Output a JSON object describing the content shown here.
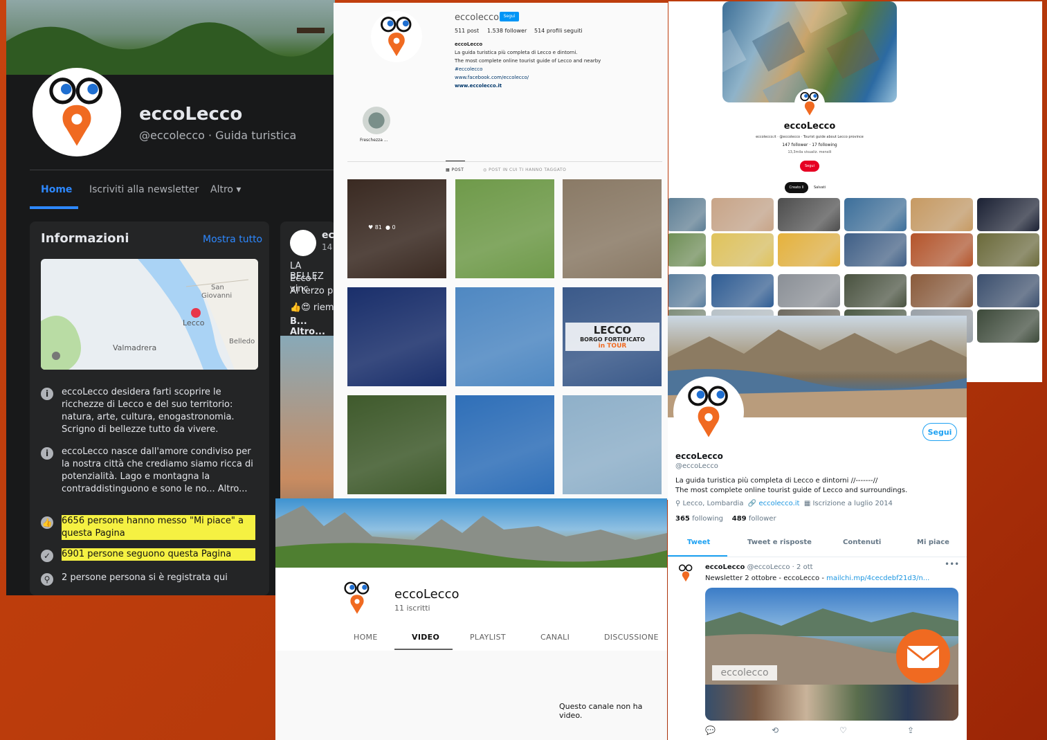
{
  "facebook": {
    "name": "eccoLecco",
    "handle": "@eccolecco · Guida turistica",
    "tabs": [
      "Home",
      "Iscriviti alla newsletter",
      "Altro ▾"
    ],
    "info": {
      "title": "Informazioni",
      "see_all": "Mostra tutto",
      "map_labels": [
        "San",
        "Giovanni",
        "Lecco",
        "Valmadrera",
        "Belledo"
      ],
      "rows": [
        "eccoLecco desidera farti scoprire le ricchezze di Lecco e del suo territorio: natura, arte, cultura, enogastronomia. Scrigno di bellezze tutto da vivere.",
        "eccoLecco nasce dall'amore condiviso per la nostra città che crediamo siamo ricca di potenzialità. Lago e montagna la contraddistinguono e sono le no... Altro...",
        "6656 persone hanno messo \"Mi piace\" a questa Pagina",
        "6901 persone seguono questa Pagina",
        "2 persone persona si è registrata qui"
      ]
    },
    "post": {
      "name": "ec",
      "time": "14",
      "lines": [
        "LA BELLEZ",
        "Ecco i vinc",
        "Al terzo p",
        "riem",
        "B... Altro..."
      ]
    }
  },
  "instagram": {
    "username": "eccolecco",
    "follow": "Segui",
    "stats": [
      "511 post",
      "1.538 follower",
      "514 profili seguiti"
    ],
    "bio": [
      "eccoLecco",
      "La guida turistica più completa di Lecco e dintorni.",
      "The most complete online tourist guide of Lecco and nearby",
      "#eccolecco",
      "www.facebook.com/eccolecco/",
      "www.ecco­lecco.it"
    ],
    "highlight": "Freschezza ...",
    "tabs": [
      "▦ POST",
      "◎ POST IN CUI TI HANNO TAGGATO"
    ],
    "tile_stats": {
      "likes": "81",
      "comments": "0"
    },
    "tile_text": [
      "LECCO",
      "BORGO FORTIFICATO",
      "in TOUR"
    ],
    "tile_colors": [
      "#3a2a22",
      "#6f9a4a",
      "#8a7a66",
      "#1a2f6b",
      "#4f88c2",
      "#3b5a8a",
      "#3f5a2c",
      "#2f6fb8",
      "#8fb0c9"
    ]
  },
  "pinterest": {
    "name": "eccoLecco",
    "meta": "eccolecco.it · @eccolecco · Tourist guide about Lecco province",
    "stats": "147 follower · 17 following",
    "views": "13,3mila visualiz. mensili",
    "follow": "Segui",
    "tab_created": "Creato ll",
    "tab_saved": "Salvati",
    "tile_colors": [
      "#5c7e95",
      "#c8a487",
      "#4d4d4d",
      "#3c6f9b",
      "#c79a62",
      "#1b2134",
      "#6e8f55",
      "#e0c35a",
      "#e6b23b",
      "#3f5f87",
      "#b5542a",
      "#6b6a3a",
      "#5a7e9e",
      "#2e5c94",
      "#8a8f96",
      "#49523f",
      "#8a5a3a",
      "#3b4f6e",
      "#7e8d7a",
      "#b8c2c8",
      "#6e6a60",
      "#4c5a45",
      "#9aa1a8",
      "#3d4a3a"
    ]
  },
  "twitter": {
    "follow": "Segui",
    "name": "eccoLecco",
    "handle": "@eccoLecco",
    "bio": [
      "La guida turistica più completa di Lecco e dintorni //-------//",
      "The most complete online tourist guide of Lecco and surroundings."
    ],
    "location": "Lecco, Lombardia",
    "link": "eccolecco.it",
    "joined": "Iscrizione a luglio 2014",
    "following": "365",
    "following_label": "following",
    "followers": "489",
    "followers_label": "follower",
    "tabs": [
      "Tweet",
      "Tweet e risposte",
      "Contenuti",
      "Mi piace"
    ],
    "post_name": "eccoLecco",
    "post_meta": "@eccoLecco · 2 ott",
    "post_text": "Newsletter 2 ottobre - eccoLecco - ",
    "post_link": "mailchi.mp/4cecdebf21d3/n...",
    "media_brand": "eccolecco",
    "more": "•••",
    "actions": [
      "💬",
      "⟲",
      "♡",
      "⇪"
    ]
  },
  "youtube": {
    "name": "eccoLecco",
    "subs": "11 iscritti",
    "tabs": [
      "HOME",
      "VIDEO",
      "PLAYLIST",
      "CANALI",
      "DISCUSSIONE"
    ],
    "empty": "Questo canale non ha video."
  },
  "colors": {
    "brand_orange": "#f06a21",
    "fb_blue": "#2d88ff",
    "tw_blue": "#1da1f2",
    "pin_red": "#e60023"
  }
}
